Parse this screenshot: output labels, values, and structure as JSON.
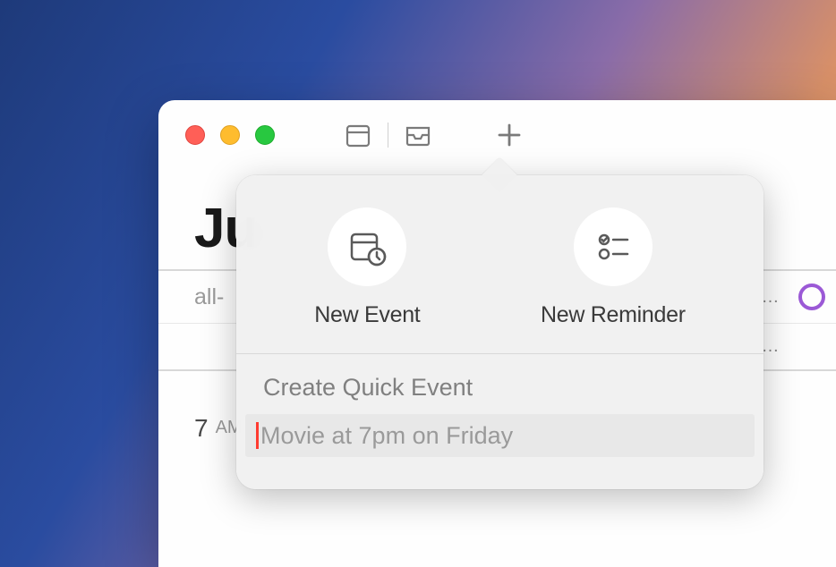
{
  "window": {
    "title_visible": "Ju",
    "traffic": [
      "close",
      "minimize",
      "maximize"
    ]
  },
  "header": {
    "allday_label": "all-"
  },
  "timeslots": [
    {
      "hour": "7",
      "ampm": "AM"
    }
  ],
  "popover": {
    "options": [
      {
        "label": "New Event",
        "icon": "calendar-clock-icon"
      },
      {
        "label": "New Reminder",
        "icon": "reminder-list-icon"
      }
    ],
    "quick_event_label": "Create Quick Event",
    "quick_event_placeholder": "Movie at 7pm on Friday",
    "quick_event_value": ""
  },
  "colors": {
    "accent_purple": "#9b59d6",
    "cursor_red": "#ff3b30"
  }
}
